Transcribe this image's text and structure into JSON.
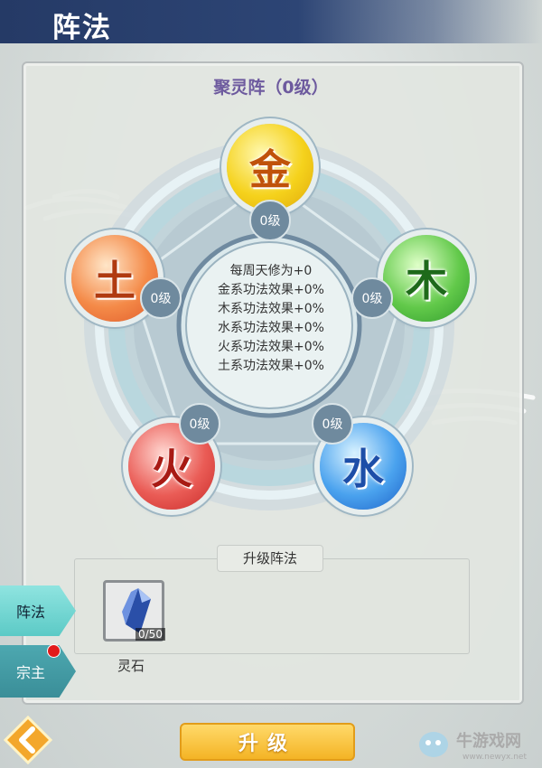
{
  "header": {
    "title": "阵法"
  },
  "formation": {
    "name": "聚灵阵（0级）",
    "center_stats": [
      "每周天修为+0",
      "金系功法效果+0%",
      "木系功法效果+0%",
      "水系功法效果+0%",
      "火系功法效果+0%",
      "土系功法效果+0%"
    ],
    "elements": [
      {
        "key": "metal",
        "char": "金",
        "level": "0级",
        "color": "#f2c416"
      },
      {
        "key": "wood",
        "char": "木",
        "level": "0级",
        "color": "#55c04c"
      },
      {
        "key": "water",
        "char": "水",
        "level": "0级",
        "color": "#3d8ee8"
      },
      {
        "key": "fire",
        "char": "火",
        "level": "0级",
        "color": "#e64a46"
      },
      {
        "key": "earth",
        "char": "土",
        "level": "0级",
        "color": "#f27a3a"
      }
    ]
  },
  "upgrade": {
    "title": "升级阵法",
    "item": {
      "name": "灵石",
      "count": "0/50",
      "icon": "spirit-stone-icon"
    },
    "button_label": "升级"
  },
  "sidebar": {
    "tabs": [
      {
        "label": "阵法",
        "active": true
      },
      {
        "label": "宗主",
        "active": false,
        "notification": true
      }
    ]
  },
  "watermark": {
    "text": "牛游戏网",
    "url": "www.newyx.net"
  },
  "colors": {
    "header": "#2d4575",
    "accent_tab": "#6fd6d2",
    "button": "#f4b425"
  }
}
